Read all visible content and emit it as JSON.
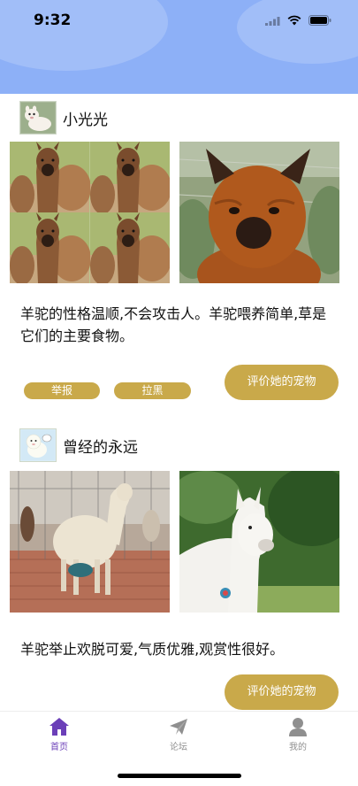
{
  "status_bar": {
    "time": "9:32"
  },
  "posts": [
    {
      "username": "小光光",
      "caption": "羊驼的性格温顺,不会攻击人。羊驼喂养简单,草是它们的主要食物。",
      "report_label": "举报",
      "block_label": "拉黑",
      "rate_label": "评价她的宠物"
    },
    {
      "username": "曾经的永远",
      "caption": "羊驼举止欢脱可爱,气质优雅,观赏性很好。",
      "rate_label": "评价她的宠物"
    }
  ],
  "tabs": [
    {
      "label": "首页",
      "icon": "home-icon",
      "active": true
    },
    {
      "label": "论坛",
      "icon": "paper-plane-icon",
      "active": false
    },
    {
      "label": "我的",
      "icon": "person-icon",
      "active": false
    }
  ],
  "colors": {
    "header": "#8db0f7",
    "accent_gold": "#c9a94a",
    "tab_active": "#6b3fb8",
    "tab_inactive": "#8f8f8f"
  }
}
